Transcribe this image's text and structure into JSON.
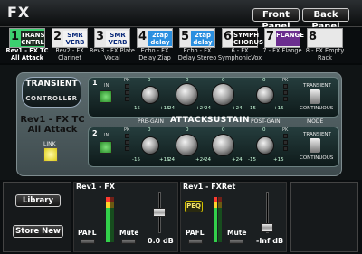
{
  "window": {
    "title": "FX",
    "front_panel_label": "Front Panel",
    "back_panel_label": "Back Panel"
  },
  "rack_slots": [
    {
      "num": "1",
      "tag": "TRANS CNTRL",
      "label": "Rev1 - FX TC All Attack",
      "selected": true
    },
    {
      "num": "2",
      "tag": "SMR VERB",
      "label": "Rev2 - FX Clarinet",
      "selected": false
    },
    {
      "num": "3",
      "tag": "SMR VERB",
      "label": "Rev3 - FX Plate Vocal",
      "selected": false
    },
    {
      "num": "4",
      "tag": "2tap delay",
      "label": "Echo - FX Delay Ziap",
      "selected": false
    },
    {
      "num": "5",
      "tag": "2tap delay",
      "label": "Echo - FX Delay Stereo",
      "selected": false
    },
    {
      "num": "6",
      "tag": "SYMPH CHORUS",
      "label": "6 - FX SymphonicVox",
      "selected": false
    },
    {
      "num": "7",
      "tag": "FLANGE",
      "label": "7 - FX Flange",
      "selected": false
    },
    {
      "num": "8",
      "tag": "",
      "label": "8 - FX Empty Rack",
      "selected": false
    }
  ],
  "transient_controller": {
    "logo_top": "TRANSIENT",
    "logo_bottom": "CONTROLLER",
    "preset_name": "Rev1 - FX TC All Attack",
    "link_label": "LINK",
    "sections": {
      "pre_gain": "PRE-GAIN",
      "attack": "ATTACK",
      "sustain": "SUSTAIN",
      "post_gain": "POST-GAIN",
      "mode": "MODE"
    },
    "in_label": "IN",
    "pk_label": "PK",
    "mode_top": "TRANSIENT",
    "mode_bottom": "CONTINUOUS",
    "channels": [
      {
        "num": "1",
        "ticks": {
          "pre_min": "-15",
          "pre_mid": "0",
          "pre_max": "+15",
          "att_min": "-24",
          "att_mid": "0",
          "att_max": "+24",
          "sus_min": "-24",
          "sus_mid": "0",
          "sus_max": "+24",
          "post_min": "-15",
          "post_mid": "0",
          "post_max": "+15"
        }
      },
      {
        "num": "2",
        "ticks": {
          "pre_min": "-15",
          "pre_mid": "0",
          "pre_max": "+15",
          "att_min": "-24",
          "att_mid": "0",
          "att_max": "+24",
          "sus_min": "-24",
          "sus_mid": "0",
          "sus_max": "+24",
          "post_min": "-15",
          "post_mid": "0",
          "post_max": "+15"
        }
      }
    ]
  },
  "library": {
    "library_label": "Library",
    "store_label": "Store New"
  },
  "strip_fx": {
    "title": "Rev1 - FX",
    "pafl_label": "PAFL",
    "mute_label": "Mute",
    "level": "0.0 dB"
  },
  "strip_fxret": {
    "title": "Rev1 - FXRet",
    "peq_label": "PEQ",
    "pafl_label": "PAFL",
    "mute_label": "Mute",
    "level": "-Inf dB"
  }
}
